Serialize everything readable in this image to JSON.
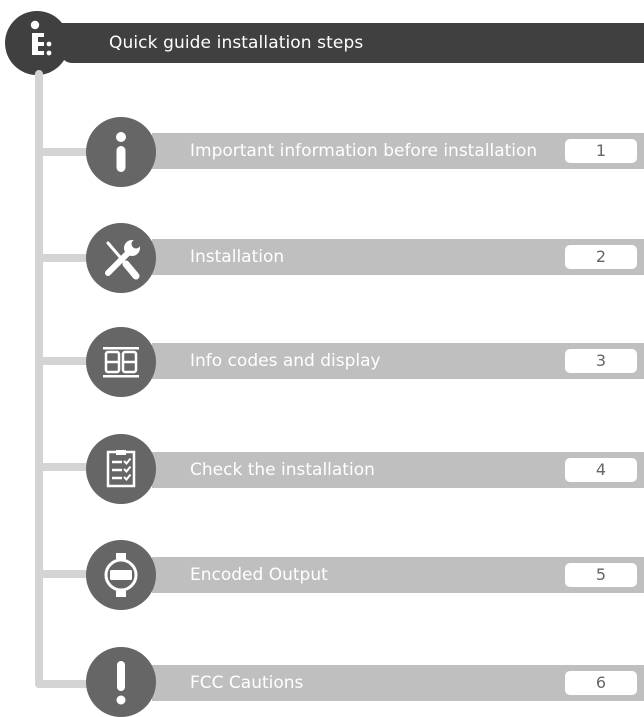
{
  "header": {
    "title": "Quick guide installation steps",
    "icon": "guide-steps-icon"
  },
  "steps": [
    {
      "label": "Important information before installation",
      "number": "1",
      "icon": "info-icon"
    },
    {
      "label": "Installation",
      "number": "2",
      "icon": "tools-icon"
    },
    {
      "label": "Info codes and display",
      "number": "3",
      "icon": "display-digits-icon"
    },
    {
      "label": "Check the installation",
      "number": "4",
      "icon": "checklist-icon"
    },
    {
      "label": "Encoded Output",
      "number": "5",
      "icon": "meter-icon"
    },
    {
      "label": "FCC Cautions",
      "number": "6",
      "icon": "exclamation-icon"
    }
  ],
  "colors": {
    "header": "#404040",
    "circle": "#666666",
    "bar": "#bfbfbf",
    "connector": "#d4d4d4"
  }
}
